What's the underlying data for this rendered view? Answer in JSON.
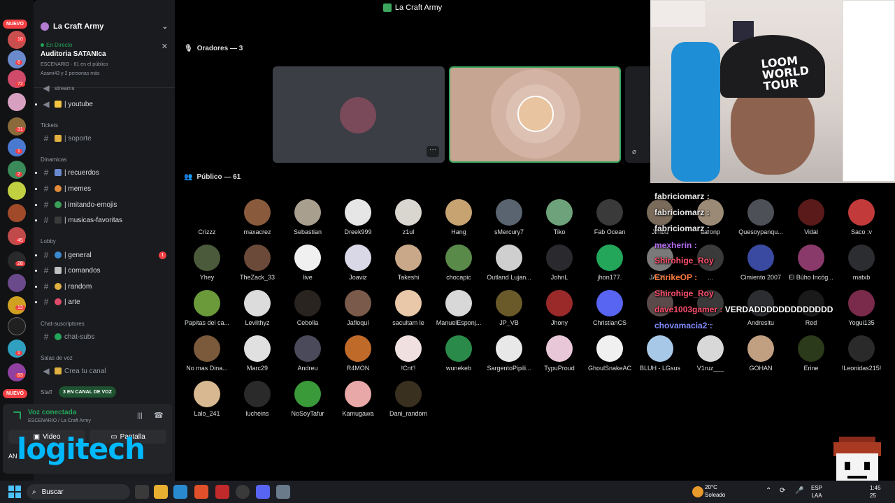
{
  "window": {
    "title": "La Craft Army"
  },
  "rail": {
    "nuevo_top": "NUEVO",
    "nuevo_bottom": "NUEVO",
    "badges": [
      "10",
      "6",
      "72",
      "31",
      "1",
      "2",
      "45",
      "28",
      "13",
      "1",
      "83"
    ]
  },
  "server": {
    "name": "La Craft Army"
  },
  "live": {
    "tag": "En Directo",
    "title": "Auditoria SATANIca",
    "meta": "ESCENARIO · 61 en el público",
    "meta2": "Azami43 y 2 personas más"
  },
  "channels": {
    "streams": "streams",
    "youtube": "| youtube",
    "cat_tickets": "Tickets",
    "soporte": "| soporte",
    "cat_dinamicas": "Dinamicas",
    "recuerdos": "| recuerdos",
    "memes": "| memes",
    "imitando": "| imitando-emojis",
    "musicas": "| musicas-favoritas",
    "cat_lobby": "Lobby",
    "general": "| general",
    "general_badge": "1",
    "comandos": "| comandos",
    "random": "| random",
    "arte": "| arte",
    "cat_chatsus": "Chat-suscriptores",
    "chatsubs": "chat-subs",
    "cat_salas": "Salas de voz",
    "crea": "Crea tu canal",
    "cat_staff": "Staff",
    "staff_pill": "3 EN CANAL DE VOZ"
  },
  "voice": {
    "title": "Voz conectada",
    "sub": "ESCENARIO / La Craft Army",
    "video": "Video",
    "screen": "Pantalla",
    "user": "AN",
    "brand": "logitech"
  },
  "stage": {
    "speakers_header": "Oradores — 3",
    "audience_header": "Público — 61",
    "more": "···"
  },
  "audience": [
    {
      "name": "Crizzz",
      "color": "#000000"
    },
    {
      "name": "maxacrez",
      "color": "#8a5a3c"
    },
    {
      "name": "Sebastian",
      "color": "#a89f8e"
    },
    {
      "name": "Dreek999",
      "color": "#e6e6e6"
    },
    {
      "name": "z1ul",
      "color": "#d9d5cf"
    },
    {
      "name": "Hang",
      "color": "#c7a372"
    },
    {
      "name": "sMercury7",
      "color": "#5a6470"
    },
    {
      "name": "Tiko",
      "color": "#6ea27a"
    },
    {
      "name": "Fab Ocean",
      "color": "#3a3a3a"
    },
    {
      "name": "Jimbu",
      "color": "#7a6a5a"
    },
    {
      "name": "aaronp",
      "color": "#9b8a76"
    },
    {
      "name": "Quesoypanqu...",
      "color": "#4e5058"
    },
    {
      "name": "Vidal",
      "color": "#5a1a1a"
    },
    {
      "name": "Saco :v",
      "color": "#c23a3a"
    },
    {
      "name": "Yhey",
      "color": "#4b5a3a"
    },
    {
      "name": "TheZack_33",
      "color": "#6b4a3a"
    },
    {
      "name": "live",
      "color": "#f0f0f0"
    },
    {
      "name": "Joaviz",
      "color": "#d8d8e6"
    },
    {
      "name": "Takeshi",
      "color": "#c9a88a"
    },
    {
      "name": "chocapic",
      "color": "#5a8a4a"
    },
    {
      "name": "Outland Lujan...",
      "color": "#cfcfcf"
    },
    {
      "name": "JohnL",
      "color": "#2a2a2e"
    },
    {
      "name": "jhon177.",
      "color": "#23a55a"
    },
    {
      "name": "JACK...",
      "color": "#7a7a7a"
    },
    {
      "name": "...",
      "color": "#3a3a3a"
    },
    {
      "name": "Cimiento 2007",
      "color": "#3a4aa0"
    },
    {
      "name": "El Búho Incóg...",
      "color": "#8a3a6a"
    },
    {
      "name": "matxb",
      "color": "#2b2d31"
    },
    {
      "name": "Papitas del ca...",
      "color": "#6a9a3a"
    },
    {
      "name": "Levilthyz",
      "color": "#dcdcdc"
    },
    {
      "name": "Cebolla",
      "color": "#2a2420"
    },
    {
      "name": "Jafloquí",
      "color": "#7a5a4a"
    },
    {
      "name": "sacultam le",
      "color": "#e8c8a8"
    },
    {
      "name": "ManuelEsponj...",
      "color": "#d8d8d8"
    },
    {
      "name": "JP_VB",
      "color": "#6a5a2a"
    },
    {
      "name": "Jhony",
      "color": "#9a2a2a"
    },
    {
      "name": "ChristianCS",
      "color": "#5865f2"
    },
    {
      "name": "...",
      "color": "#5a4a4a"
    },
    {
      "name": "...",
      "color": "#3a3a3a"
    },
    {
      "name": "Andresitu",
      "color": "#2b2d31"
    },
    {
      "name": "Red",
      "color": "#1a1a1a"
    },
    {
      "name": "Yogui135",
      "color": "#7a2a4a"
    },
    {
      "name": "No mas Dina...",
      "color": "#7a5a3a"
    },
    {
      "name": "Marc29",
      "color": "#e0e0e0"
    },
    {
      "name": "Andreu",
      "color": "#4a4a5a"
    },
    {
      "name": "R4MON",
      "color": "#c06a2a"
    },
    {
      "name": "!Cnt'!",
      "color": "#f0e0e0"
    },
    {
      "name": "wunekeb",
      "color": "#2a8a4a"
    },
    {
      "name": "SargentoPipili...",
      "color": "#e8e8e8"
    },
    {
      "name": "TypuProud",
      "color": "#e8c8d8"
    },
    {
      "name": "GhoulSnakeAC",
      "color": "#f0f0f0"
    },
    {
      "name": "BLUH - LGsus",
      "color": "#a8c8e8"
    },
    {
      "name": "V1ruz___",
      "color": "#d8d8d8"
    },
    {
      "name": "GOHAN",
      "color": "#c0a080"
    },
    {
      "name": "Erine",
      "color": "#2a3a1a"
    },
    {
      "name": "!Leonidas215!",
      "color": "#2a2a2a"
    },
    {
      "name": "Lalo_241",
      "color": "#d8b890"
    },
    {
      "name": "lucheins",
      "color": "#2a2a2a"
    },
    {
      "name": "NoSoyTafur",
      "color": "#3a9a3a"
    },
    {
      "name": "Kamugawa",
      "color": "#e8a8a8"
    },
    {
      "name": "Dani_random",
      "color": "#3a3020"
    }
  ],
  "chat": [
    {
      "user": "fabriciomarz :",
      "msg": ""
    },
    {
      "user": "fabriciomarz :",
      "msg": ""
    },
    {
      "user": "fabriciomarz :",
      "msg": ""
    },
    {
      "user": "mexherin :",
      "msg": ""
    },
    {
      "user": "Shirohige_Roy",
      "msg": ""
    },
    {
      "user": "EnrikeOP :",
      "msg": ""
    },
    {
      "user": "Shirohige_Roy",
      "msg": ""
    },
    {
      "user": "dave1003gamer :",
      "msg": "VERDADDDDDDDDDDDDD"
    },
    {
      "user": "chovamacia2 :",
      "msg": ""
    }
  ],
  "webcam": {
    "cap_text": "LOOM WORLD TOUR"
  },
  "taskbar": {
    "search": "Buscar",
    "temp": "20°C",
    "weather": "Soleado",
    "lang1": "ESP",
    "lang2": "LAA",
    "time": "1:45",
    "date": "25"
  }
}
